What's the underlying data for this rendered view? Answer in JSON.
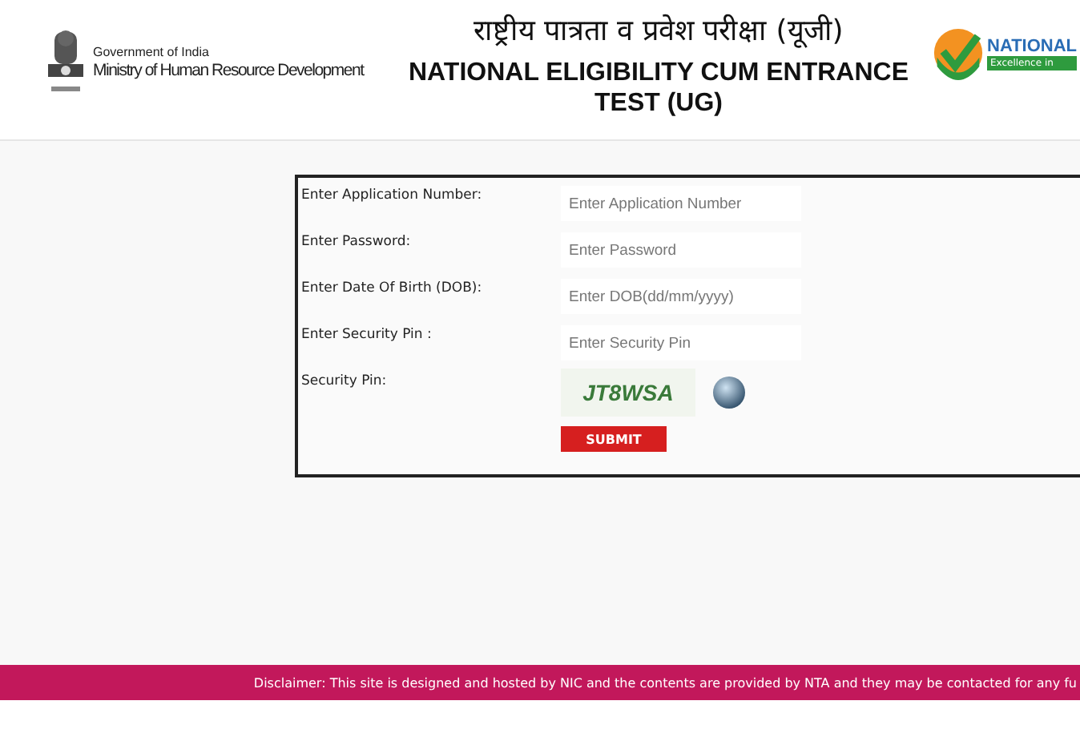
{
  "header": {
    "ministry_small": "Government of India",
    "ministry": "Ministry of Human Resource Development",
    "title_hindi": "राष्ट्रीय पात्रता व प्रवेश परीक्षा (यूजी)",
    "title_lines": [
      "NATIONAL ELIGIBILITY CUM ENTRANCE",
      "TEST (UG)"
    ],
    "agency": "NATIONAL",
    "agency_tagline": "Excellence in"
  },
  "form": {
    "fields": [
      {
        "kind": "input",
        "label": "Enter Application Number:",
        "placeholder": "Enter Application Number"
      },
      {
        "kind": "input",
        "label": "Enter Password:",
        "placeholder": "Enter Password"
      },
      {
        "kind": "input",
        "label": "Enter Date Of Birth (DOB):",
        "placeholder": "Enter DOB(dd/mm/yyyy)"
      },
      {
        "kind": "input",
        "label": "Enter Security Pin :",
        "placeholder": "Enter Security Pin"
      },
      {
        "kind": "captcha",
        "label": "Security Pin:",
        "captcha": "JT8WSA"
      }
    ],
    "submit": "SUBMIT"
  },
  "footer": {
    "disclaimer": "Disclaimer: This site is designed and hosted by NIC and the contents are provided by NTA and they may be contacted for any fu"
  }
}
